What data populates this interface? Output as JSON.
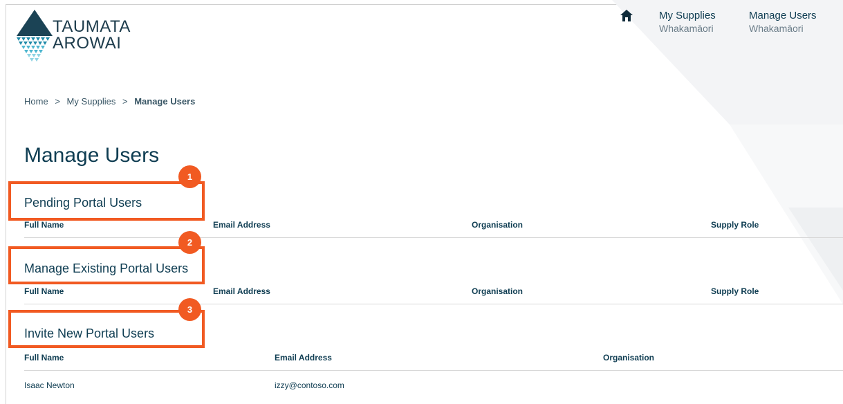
{
  "header": {
    "logo_line1": "TAUMATA",
    "logo_line2": "AROWAI",
    "nav": [
      {
        "label": "My Supplies",
        "sublabel": "Whakamāori"
      },
      {
        "label": "Manage Users",
        "sublabel": "Whakamāori"
      }
    ]
  },
  "breadcrumb": {
    "items": [
      "Home",
      "My Supplies",
      "Manage Users"
    ],
    "separators": [
      ">",
      ">"
    ]
  },
  "page": {
    "title": "Manage Users"
  },
  "sections": {
    "pending": {
      "title": "Pending Portal Users",
      "columns": [
        "Full Name",
        "Email Address",
        "Organisation",
        "Supply Role"
      ]
    },
    "existing": {
      "title": "Manage Existing Portal Users",
      "columns": [
        "Full Name",
        "Email Address",
        "Organisation",
        "Supply Role"
      ]
    },
    "invite": {
      "title": "Invite New Portal Users",
      "columns": [
        "Full Name",
        "Email Address",
        "Organisation"
      ],
      "rows": [
        {
          "full_name": "Isaac Newton",
          "email": "izzy@contoso.com",
          "organisation": ""
        }
      ]
    }
  },
  "callouts": [
    "1",
    "2",
    "3"
  ],
  "colors": {
    "accent": "#f15a22",
    "primary": "#0f3d52",
    "logo_teal": "#1f8aa8"
  },
  "icons": {
    "home": "home-icon",
    "logo": "logo-mark-icon"
  }
}
